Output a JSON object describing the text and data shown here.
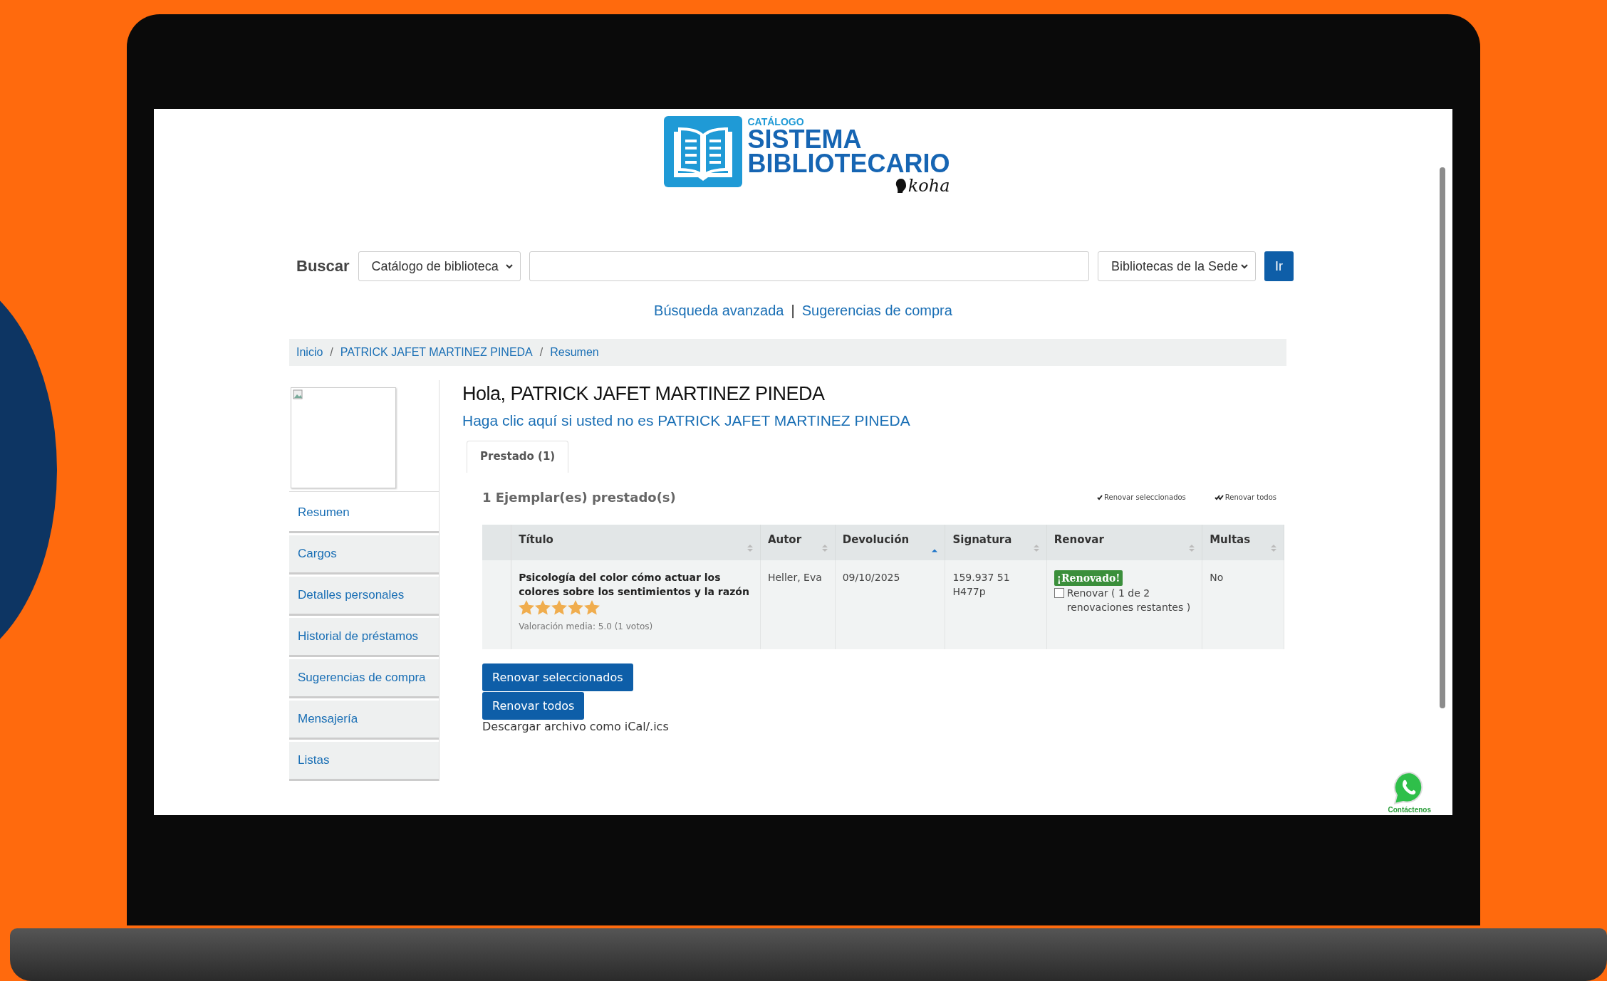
{
  "logo": {
    "overline": "CATÁLOGO",
    "line1": "SISTEMA",
    "line2": "BIBLIOTECARIO",
    "brand": "koha"
  },
  "search": {
    "label": "Buscar",
    "scope": "Catálogo de biblioteca",
    "library": "Bibliotecas de la Sede",
    "button": "Ir"
  },
  "links": [
    "Búsqueda avanzada",
    "Sugerencias de compra"
  ],
  "links_separator": "|",
  "breadcrumb": [
    "Inicio",
    "PATRICK JAFET MARTINEZ PINEDA",
    "Resumen"
  ],
  "breadcrumb_separator": "/",
  "sidebar": {
    "items": [
      {
        "label": "Resumen",
        "selected": true
      },
      {
        "label": "Cargos",
        "selected": false
      },
      {
        "label": "Detalles personales",
        "selected": false
      },
      {
        "label": "Historial de préstamos",
        "selected": false
      },
      {
        "label": "Sugerencias de compra",
        "selected": false
      },
      {
        "label": "Mensajería",
        "selected": false
      },
      {
        "label": "Listas",
        "selected": false
      }
    ]
  },
  "greeting": "Hola, PATRICK JAFET MARTINEZ PINEDA",
  "not_you_link": "Haga clic aquí si usted no es PATRICK JAFET MARTINEZ PINEDA",
  "tabs": [
    {
      "label": "Prestado (1)",
      "selected": true
    }
  ],
  "checkouts_count": "1 Ejemplar(es) prestado(s)",
  "quick_actions": [
    {
      "label": "Renovar seleccionados",
      "kind": "single"
    },
    {
      "label": "Renovar todos",
      "kind": "double"
    }
  ],
  "table": {
    "columns": [
      {
        "label": "Título",
        "sorted": false
      },
      {
        "label": "Autor",
        "sorted": false
      },
      {
        "label": "Devolución",
        "sorted": true
      },
      {
        "label": "Signatura",
        "sorted": false
      },
      {
        "label": "Renovar",
        "sorted": false
      },
      {
        "label": "Multas",
        "sorted": false
      }
    ],
    "rows": [
      {
        "title": "Psicología del color cómo actuar los colores sobre los sentimientos y la razón",
        "stars": 5,
        "rating": "Valoración media: 5.0 (1 votos)",
        "author": "Heller, Eva",
        "due": "09/10/2025",
        "call_number": "159.937 51 H477p",
        "renew_badge": "¡Renovado!",
        "renew_checked": false,
        "renew_label": "Renovar ( 1 de 2 renovaciones restantes )",
        "fines": "No"
      }
    ]
  },
  "buttons": [
    "Renovar seleccionados",
    "Renovar todos"
  ],
  "ical_link": "Descargar archivo como iCal/.ics",
  "chat": {
    "label": "Contáctenos"
  }
}
